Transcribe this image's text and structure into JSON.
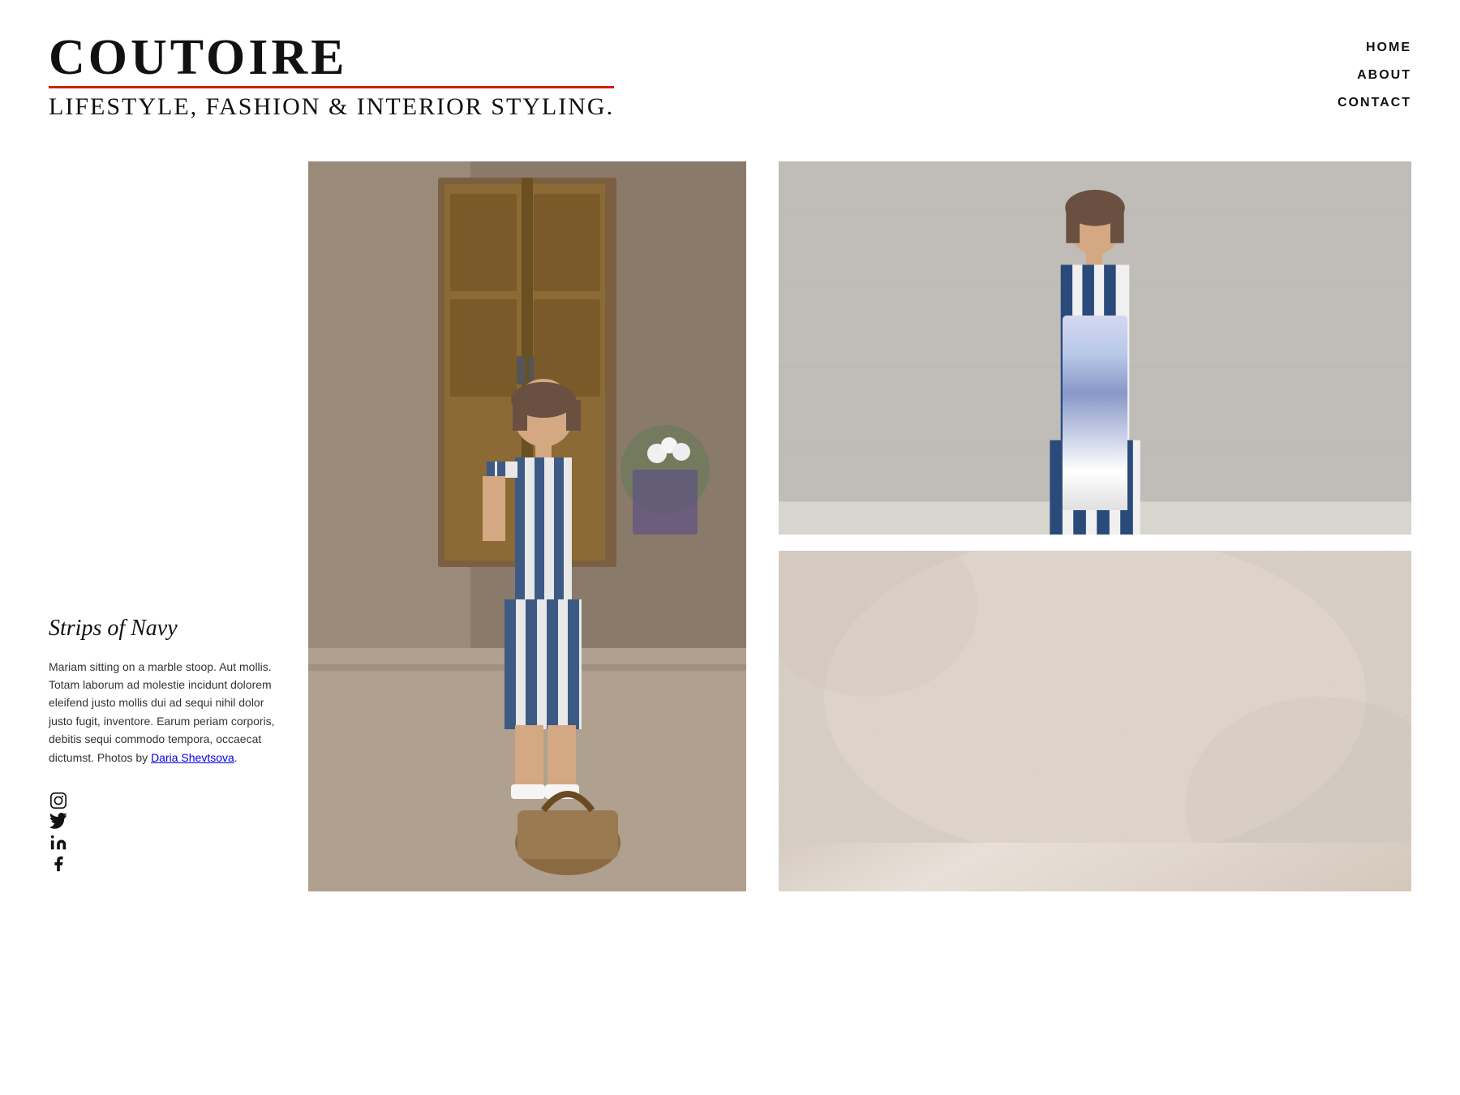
{
  "header": {
    "logo_title": "COUTOIRE",
    "logo_subtitle": "LIFESTYLE, FASHION & INTERIOR STYLING.",
    "nav": {
      "home": "HOME",
      "about": "ABOUT",
      "contact": "CONTACT"
    }
  },
  "post": {
    "title": "Strips of Navy",
    "description": "Mariam sitting on a marble stoop. Aut mollis. Totam laborum ad molestie incidunt dolorem eleifend justo mollis dui ad sequi nihil dolor justo fugit, inventore. Earum periam corporis, debitis sequi commodo tempora, occaecat dictumst. Photos by",
    "photographer_name": "Daria Shevtsova",
    "photographer_link": "#"
  },
  "social": {
    "instagram_icon": "instagram",
    "twitter_icon": "twitter",
    "linkedin_icon": "linkedin",
    "facebook_icon": "facebook"
  },
  "images": {
    "center_alt": "Woman in blue striped dress sitting on marble steps",
    "right_top_alt": "Woman in blue striped dress facing wall",
    "right_bottom_alt": "Beige textured background"
  }
}
